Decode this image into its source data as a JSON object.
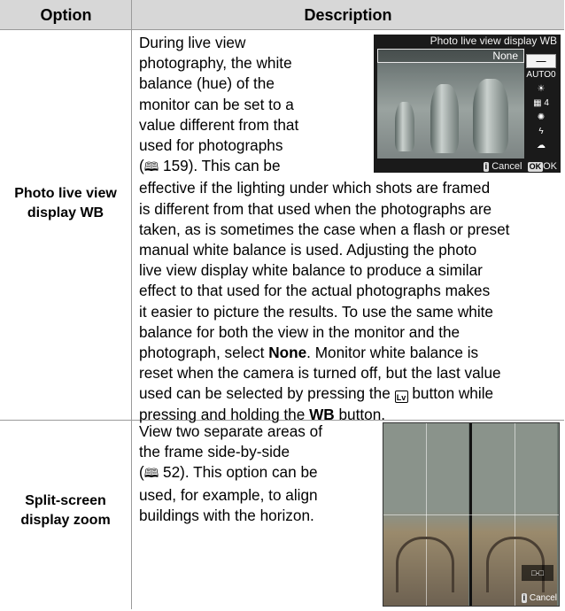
{
  "table": {
    "header": {
      "option": "Option",
      "description": "Description"
    },
    "rows": [
      {
        "option_line1": "Photo live view",
        "option_line2": "display WB",
        "desc_wrap": [
          "During live view",
          "photography, the white",
          "balance (hue) of the",
          "monitor can be set to a",
          "value different from that",
          "used for photographs"
        ],
        "desc_ref_open": "(",
        "desc_ref_num": "159).  This can be",
        "desc_full": [
          "effective if the lighting under which shots are framed",
          "is different from that used when the photographs are",
          "taken, as is sometimes the case when a flash or preset",
          "manual white balance is used.  Adjusting the photo",
          "live view display white balance to produce a similar",
          "effect to that used for the actual photographs makes",
          "it easier to picture the results.  To use the same white",
          "balance for both the view in the monitor and the"
        ],
        "desc_sel_pre": "photograph, select ",
        "desc_sel_bold": "None",
        "desc_sel_post": ".  Monitor white balance is",
        "desc_reset": "reset when the camera is turned off, but the last value",
        "desc_press_pre": "used can be selected by pressing the ",
        "desc_press_post": " button while",
        "desc_hold_pre": "pressing and holding the ",
        "desc_hold_bold": "WB",
        "desc_hold_post": " button.",
        "lv_icon": "Lv",
        "screen": {
          "title": "Photo live view display WB",
          "selected": "None",
          "menu_items": [
            "--",
            "AUTO0",
            "sun",
            "fluor 4",
            "incand",
            "flash",
            "shade"
          ],
          "menu_labels": [
            "‒‒",
            "AUTO0",
            "☀",
            "▦ 4",
            "✺",
            "ϟ",
            "☁"
          ],
          "cancel_badge": "i",
          "cancel": "Cancel",
          "ok_badge": "OK",
          "ok": "OK"
        }
      },
      {
        "option_line1": "Split-screen",
        "option_line2": "display zoom",
        "desc_lines": [
          "View two separate areas of",
          "the frame side-by-side"
        ],
        "desc_ref_open": "(",
        "desc_ref_num": "52).  This option can be",
        "desc_rest": [
          "used, for example, to align",
          "buildings with the horizon."
        ],
        "screen": {
          "cancel_badge": "i",
          "cancel": "Cancel",
          "pos_label": "□-□"
        }
      }
    ]
  },
  "icons": {
    "page_ref": "book-icon",
    "lv_button": "lv-button-icon"
  }
}
